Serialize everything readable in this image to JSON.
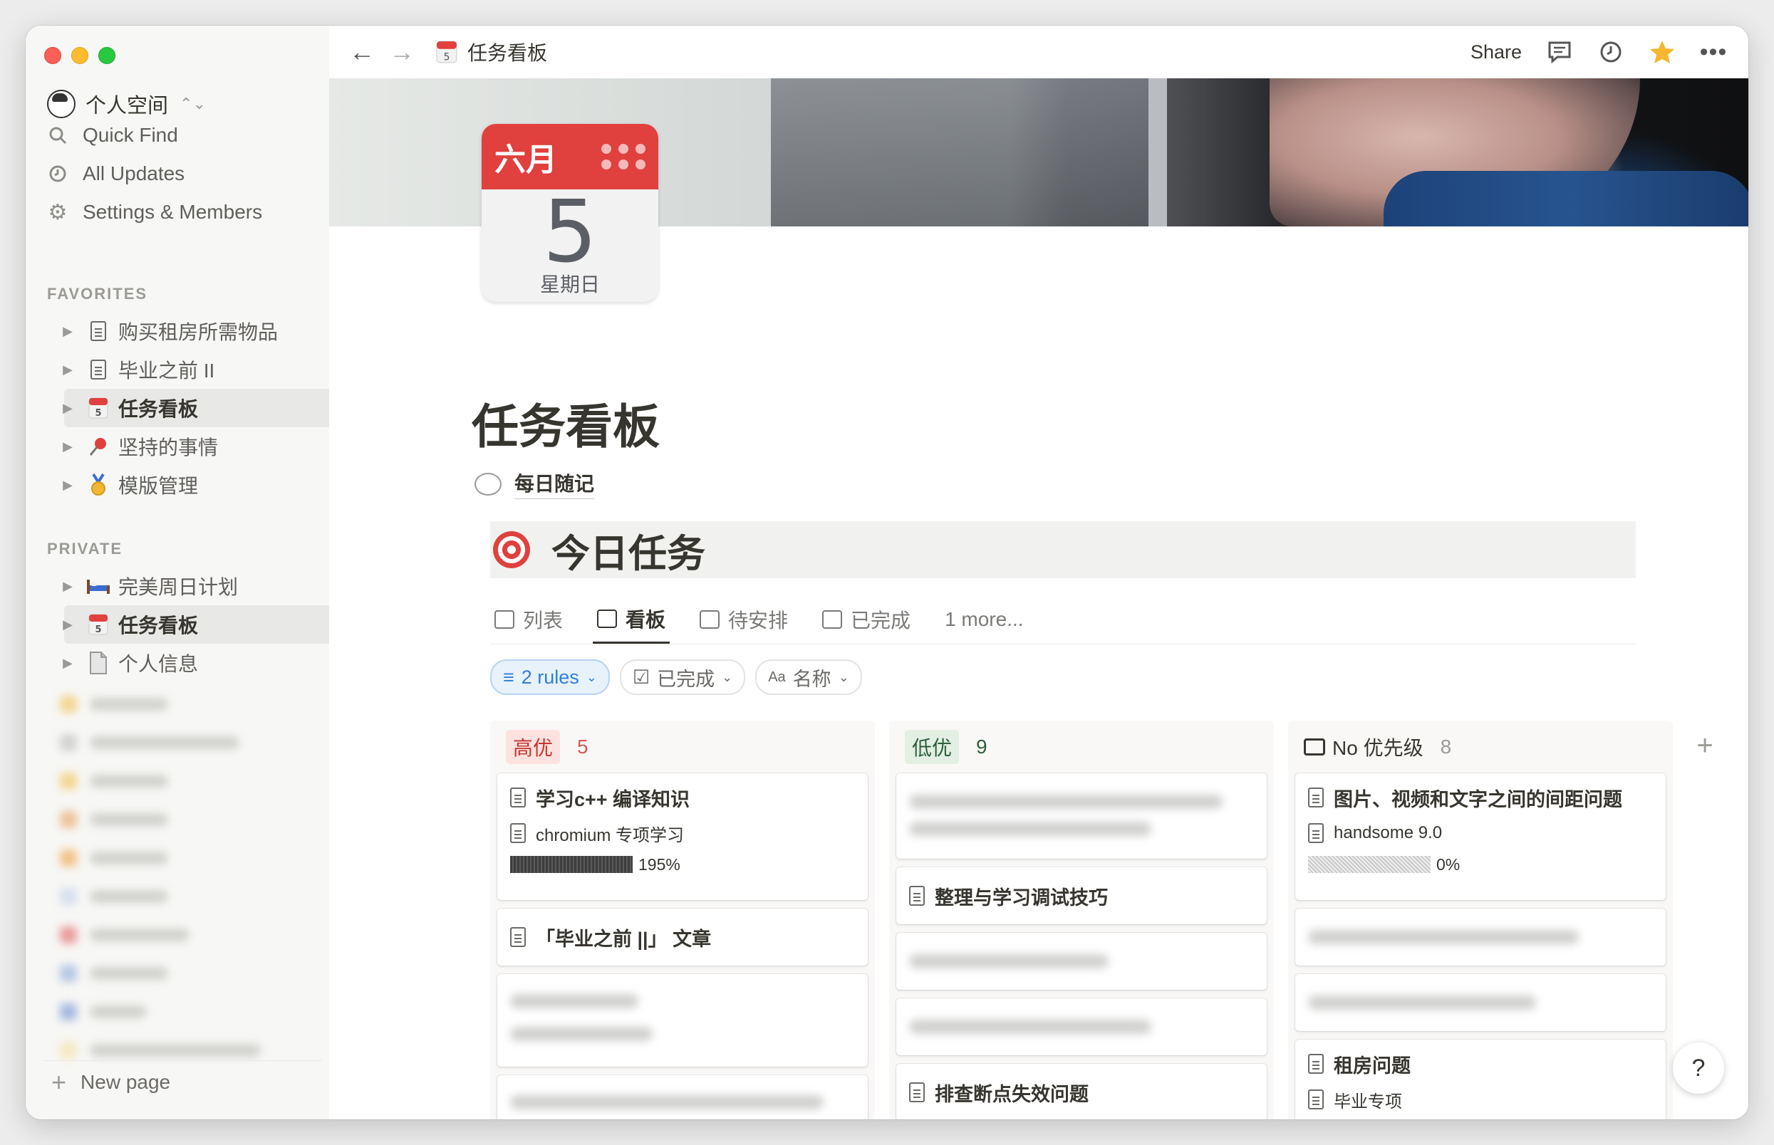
{
  "sidebar": {
    "workspace": "个人空间",
    "nav": [
      "Quick Find",
      "All Updates",
      "Settings & Members"
    ],
    "favorites_label": "FAVORITES",
    "favorites": [
      "购买租房所需物品",
      "毕业之前 II",
      "任务看板",
      "坚持的事情",
      "模版管理"
    ],
    "private_label": "PRIVATE",
    "private": [
      "完美周日计划",
      "任务看板",
      "个人信息"
    ],
    "new_page": "New page"
  },
  "topbar": {
    "breadcrumb": "任务看板",
    "share": "Share"
  },
  "calendar": {
    "month": "六月",
    "day": "5",
    "weekday": "星期日"
  },
  "page": {
    "title": "任务看板",
    "sub_link": "每日随记",
    "section": "今日任务"
  },
  "tabs": [
    "列表",
    "看板",
    "待安排",
    "已完成",
    "1 more..."
  ],
  "filters": {
    "rules": "2 rules",
    "done": "已完成",
    "name": "名称"
  },
  "board": {
    "columns": [
      {
        "tag": "高优",
        "count": "5",
        "cards": [
          {
            "title": "学习c++ 编译知识",
            "sub": "chromium 专项学习",
            "progress": "195%"
          },
          {
            "title": "「毕业之前 ||」 文章"
          }
        ]
      },
      {
        "tag": "低优",
        "count": "9",
        "cards": [
          {
            "title": "整理与学习调试技巧"
          },
          {
            "title": "排查断点失效问题"
          }
        ]
      },
      {
        "tag": "No 优先级",
        "count": "8",
        "cards": [
          {
            "title": "图片、视频和文字之间的间距问题",
            "sub": "handsome 9.0",
            "progress": "0%"
          },
          {
            "title": "租房问题",
            "sub": "毕业专项"
          }
        ]
      }
    ]
  },
  "help": "?",
  "add_group": "+"
}
